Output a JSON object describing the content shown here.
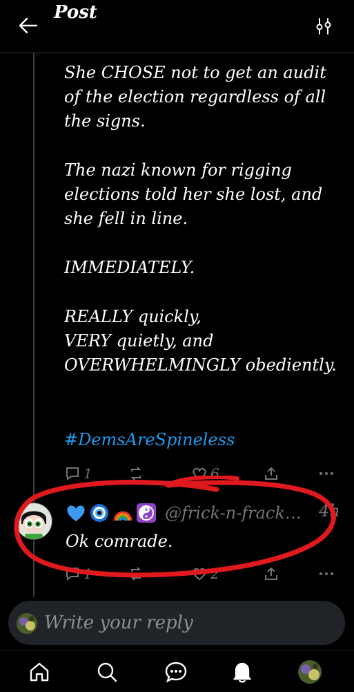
{
  "header": {
    "title": "Post",
    "back_icon": "arrow-left-icon",
    "options_icon": "tune-icon"
  },
  "post": {
    "paragraphs": [
      "She CHOSE not to get an audit of the election regardless of all the signs.",
      "The nazi known for rigging elections told her she lost, and she fell in line.",
      "IMMEDIATELY.",
      "REALLY quickly,\nVERY quietly, and\nOVERWHELMINGLY obediently."
    ],
    "hashtag": "#DemsAreSpineless",
    "replies_count": "1",
    "reposts_count": "",
    "likes_count": "6"
  },
  "reply": {
    "emoji_name": [
      "blue-heart",
      "evil-eye",
      "rainbow",
      "yin-yang"
    ],
    "handle": "@frick-n-frack…",
    "time": "4h",
    "text": "Ok comrade.",
    "replies_count": "1",
    "likes_count": "2"
  },
  "compose": {
    "placeholder": "Write your reply"
  },
  "nav": [
    "home-icon",
    "search-icon",
    "chat-icon",
    "bell-icon",
    "profile-avatar"
  ],
  "colors": {
    "background": "#000000",
    "accent": "#1d9bf0",
    "muted": "#71767b",
    "annotation": "#e0191f"
  }
}
